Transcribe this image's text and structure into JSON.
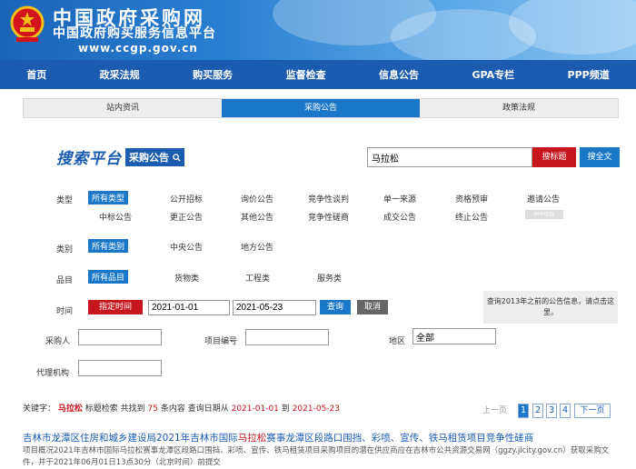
{
  "header": {
    "site_name": "中国政府采购网",
    "site_sub": "中国政府购买服务信息平台",
    "site_url": "www.ccgp.gov.cn"
  },
  "nav": [
    "首页",
    "政采法规",
    "购买服务",
    "监督检查",
    "信息公告",
    "GPA专栏",
    "PPP频道"
  ],
  "subnav": [
    {
      "label": "站内资讯",
      "active": false
    },
    {
      "label": "采购公告",
      "active": true
    },
    {
      "label": "政策法规",
      "active": false
    }
  ],
  "search": {
    "logo_text": "搜索平台",
    "logo_pill": "采购公告",
    "keyword": "马拉松",
    "btn_title": "搜标题",
    "btn_full": "搜全文"
  },
  "filters": {
    "type_label": "类型",
    "type_options_row1": [
      "所有类型",
      "公开招标",
      "询价公告",
      "竞争性谈判",
      "单一来源",
      "资格预审",
      "邀请公告"
    ],
    "type_options_row2": [
      "中标公告",
      "更正公告",
      "其他公告",
      "竞争性磋商",
      "成交公告",
      "终止公告"
    ],
    "type_extra": "PPP项目",
    "category_label": "类别",
    "category_options": [
      "所有类别",
      "中央公告",
      "地方公告"
    ],
    "item_label": "品目",
    "item_options": [
      "所有品目",
      "货物类",
      "工程类",
      "服务类"
    ],
    "time_label": "时间",
    "time_btn": "指定时间",
    "date_from": "2021-01-01",
    "date_to": "2021-05-23",
    "query_btn": "查询",
    "cancel_btn": "取消",
    "old_query_tip": "查询2013年之前的公告信息，请点击这里。",
    "purchaser_label": "采购人",
    "project_no_label": "项目编号",
    "region_label": "地区",
    "region_value": "全部",
    "agency_label": "代理机构"
  },
  "summary": {
    "prefix": "关键字：",
    "keyword": "马拉松",
    "mode": "标题检索 共找到",
    "count": "75",
    "count_suffix": "条内容 查询日期从",
    "from": "2021-01-01",
    "to_word": "到",
    "to": "2021-05-23"
  },
  "pager": {
    "prev": "上一页",
    "pages": [
      "1",
      "2",
      "3",
      "4"
    ],
    "next": "下一页"
  },
  "result": {
    "title_pre": "吉林市龙潭区住房和城乡建设局2021年吉林市国际",
    "title_hl": "马拉松",
    "title_post": "赛事龙潭区段路口围挡、彩喷、宣传、铁马租赁项目竞争性磋商",
    "desc": "项目概况2021年吉林市国际马拉松赛事龙潭区段路口围挡、彩喷、宣传、铁马租赁项目采购项目的潜在供应商应在吉林市公共资源交易网（ggzy.jlcity.gov.cn）获取采购文件，并于2021年06月01日13点30分（北京时间）前提交"
  }
}
